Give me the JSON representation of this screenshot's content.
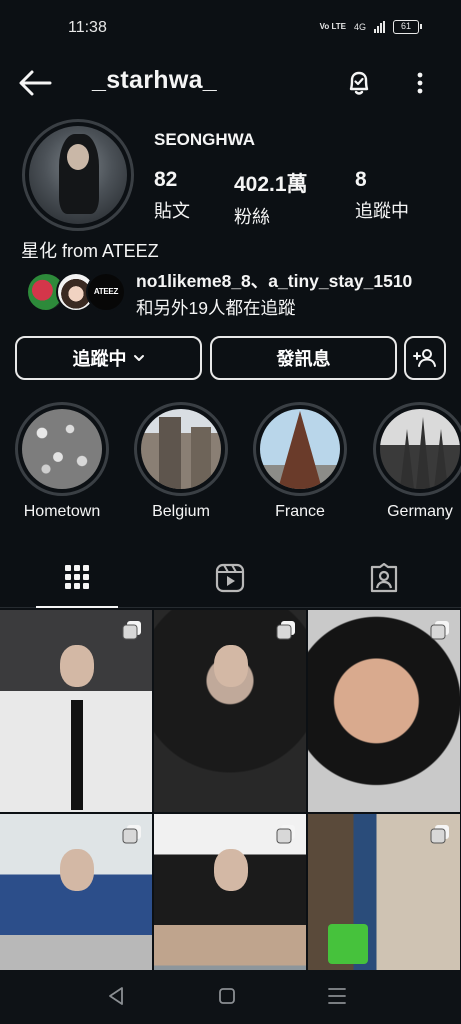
{
  "status_bar": {
    "time": "11:38",
    "volte": "Vo LTE",
    "network": "4G",
    "battery": "61"
  },
  "header": {
    "username": "_starhwa_"
  },
  "profile": {
    "display_name": "SEONGHWA",
    "stats": [
      {
        "value": "82",
        "label": "貼文"
      },
      {
        "value": "402.1萬",
        "label": "粉絲"
      },
      {
        "value": "8",
        "label": "追蹤中"
      }
    ],
    "bio": "星化 from ATEEZ",
    "mutuals": {
      "names": "no1likeme8_8、a_tiny_stay_1510",
      "tail": "和另外19人都在追蹤",
      "badge": "ATEEZ"
    }
  },
  "actions": {
    "following": "追蹤中",
    "message": "發訊息"
  },
  "highlights": [
    {
      "label": "Hometown"
    },
    {
      "label": "Belgium"
    },
    {
      "label": "France"
    },
    {
      "label": "Germany"
    }
  ],
  "colors": {
    "background": "#0c1014",
    "text": "#f5f5f5",
    "ring": "#3a3f44",
    "accent_green": "#46c23c"
  }
}
